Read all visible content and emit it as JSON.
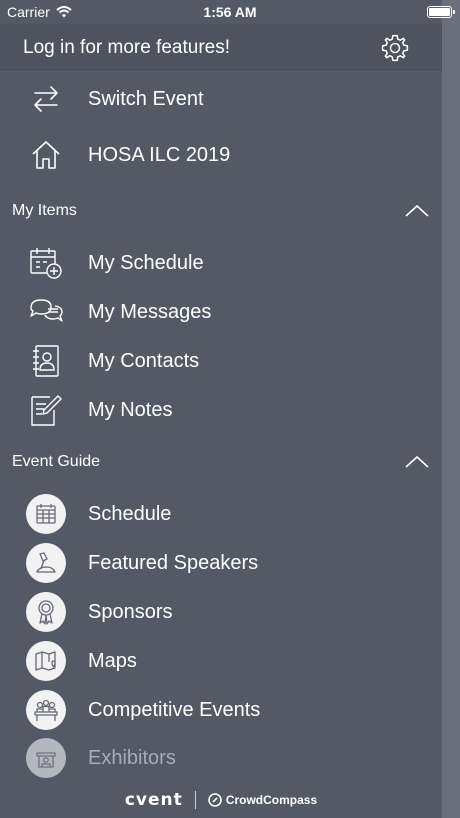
{
  "status_bar": {
    "carrier": "Carrier",
    "time": "1:56 AM"
  },
  "header": {
    "login_text": "Log in for more features!",
    "settings_icon": "gear-icon"
  },
  "top_items": [
    {
      "label": "Switch Event",
      "icon": "switch-arrows-icon"
    },
    {
      "label": "HOSA ILC 2019",
      "icon": "home-icon"
    }
  ],
  "my_items": {
    "title": "My Items",
    "items": [
      {
        "label": "My Schedule",
        "icon": "calendar-add-icon"
      },
      {
        "label": "My Messages",
        "icon": "chat-bubbles-icon"
      },
      {
        "label": "My Contacts",
        "icon": "contact-book-icon"
      },
      {
        "label": "My Notes",
        "icon": "note-pencil-icon"
      }
    ]
  },
  "event_guide": {
    "title": "Event Guide",
    "items": [
      {
        "label": "Schedule",
        "icon": "calendar-icon"
      },
      {
        "label": "Featured Speakers",
        "icon": "microphone-icon"
      },
      {
        "label": "Sponsors",
        "icon": "ribbon-icon"
      },
      {
        "label": "Maps",
        "icon": "map-icon"
      },
      {
        "label": "Competitive Events",
        "icon": "podium-people-icon"
      },
      {
        "label": "Exhibitors",
        "icon": "booth-icon"
      }
    ]
  },
  "footer": {
    "brand_left": "cvent",
    "brand_right": "CrowdCompass"
  }
}
